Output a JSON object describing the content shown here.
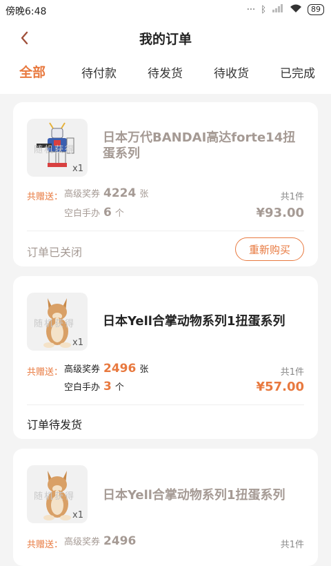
{
  "status_bar": {
    "time": "傍晚6:48",
    "battery": "89",
    "icons": [
      "signal-dots-icon",
      "bluetooth-icon",
      "cell-signal-icon",
      "wifi-icon",
      "battery-icon"
    ]
  },
  "header": {
    "title": "我的订单"
  },
  "tabs": [
    {
      "label": "全部",
      "active": true
    },
    {
      "label": "待付款"
    },
    {
      "label": "待发货"
    },
    {
      "label": "待收货"
    },
    {
      "label": "已完成"
    }
  ],
  "common": {
    "gift_label": "共赠送：",
    "ticket_label": "高级奖券",
    "ticket_unit": "张",
    "figure_label": "空白手办",
    "figure_unit": "个",
    "watermark": "随机获得",
    "rebuy_label": "重新购买"
  },
  "orders": [
    {
      "title": "日本万代BANDAI高达forte14扭蛋系列",
      "qty": "x1",
      "tickets": "4224",
      "figures": "6",
      "count": "共1件",
      "price": "¥93.00",
      "status": "订单已关闭"
    },
    {
      "title": "日本Yell合掌动物系列1扭蛋系列",
      "qty": "x1",
      "tickets": "2496",
      "figures": "3",
      "count": "共1件",
      "price": "¥57.00",
      "status": "订单待发货"
    },
    {
      "title": "日本Yell合掌动物系列1扭蛋系列",
      "qty": "x1",
      "tickets": "2496",
      "count": "共1件"
    }
  ],
  "colors": {
    "accent": "#e8793f",
    "muted": "#a59a94",
    "bg": "#f4f4f4"
  }
}
